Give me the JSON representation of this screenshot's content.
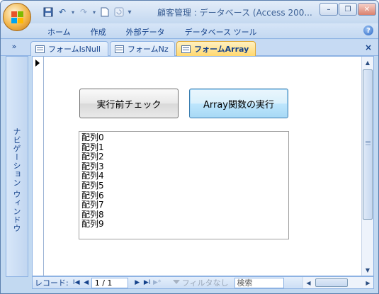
{
  "window": {
    "title": "顧客管理 : データベース (Access 200...",
    "controls": {
      "minimize": "–",
      "restore": "❐",
      "close": "✕"
    }
  },
  "qat": {
    "save": "💾",
    "undo": "↶",
    "redo": "↷",
    "new": "☐",
    "more": "▾"
  },
  "ribbon": {
    "tabs": [
      "ホーム",
      "作成",
      "外部データ",
      "データベース ツール"
    ],
    "help": "?"
  },
  "doc_tabs": {
    "toggle": "»",
    "tabs": [
      "フォームIsNull",
      "フォームNz",
      "フォームArray"
    ],
    "active_index": 2,
    "close": "×"
  },
  "nav_pane": {
    "label": "ナビゲーション ウィンドウ"
  },
  "form": {
    "buttons": {
      "check": "実行前チェック",
      "array": "Array関数の実行"
    },
    "list_items": [
      "配列0",
      "配列1",
      "配列2",
      "配列3",
      "配列4",
      "配列5",
      "配列6",
      "配列7",
      "配列8",
      "配列9"
    ]
  },
  "record_nav": {
    "label": "レコード:",
    "first": "I◀",
    "prev": "◀",
    "current": "1 / 1",
    "next": "▶",
    "last": "▶I",
    "new": "▶*",
    "filter": "フィルタなし",
    "search": "検索"
  },
  "scroll": {
    "up": "▲",
    "down": "▼",
    "left": "◀",
    "right": "▶"
  },
  "colors": {
    "accent_tab": "#ffd86f",
    "frame": "#c2d9f1",
    "text": "#15428b"
  }
}
